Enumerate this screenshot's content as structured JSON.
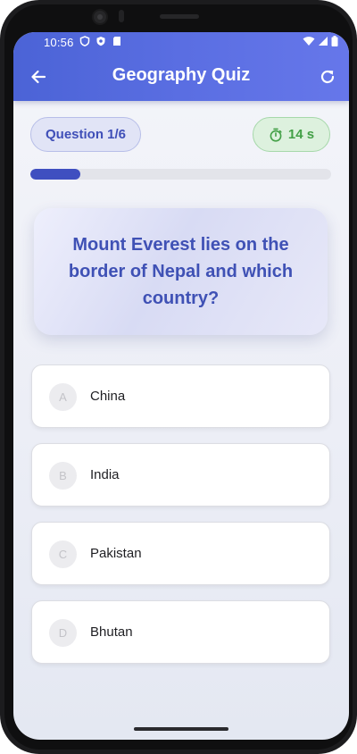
{
  "status_bar": {
    "time": "10:56",
    "icons_left": [
      "shield-icon",
      "privacy-icon",
      "sd-card-icon"
    ],
    "icons_right": [
      "wifi-icon",
      "signal-icon",
      "battery-icon"
    ]
  },
  "app_bar": {
    "title": "Geography Quiz",
    "left_icon": "back-arrow-icon",
    "right_icon": "refresh-icon",
    "color": "#4b63d6"
  },
  "quiz": {
    "question_label": "Question 1/6",
    "timer_label": "14 s",
    "progress_fraction": 0.167,
    "question_text": "Mount Everest lies on the border of Nepal and which country?",
    "options": [
      {
        "letter": "A",
        "text": "China"
      },
      {
        "letter": "B",
        "text": "India"
      },
      {
        "letter": "C",
        "text": "Pakistan"
      },
      {
        "letter": "D",
        "text": "Bhutan"
      }
    ]
  },
  "colors": {
    "accent": "#3f51b5",
    "timer_green": "#43a047",
    "progress_fill": "#3f4fc0"
  }
}
